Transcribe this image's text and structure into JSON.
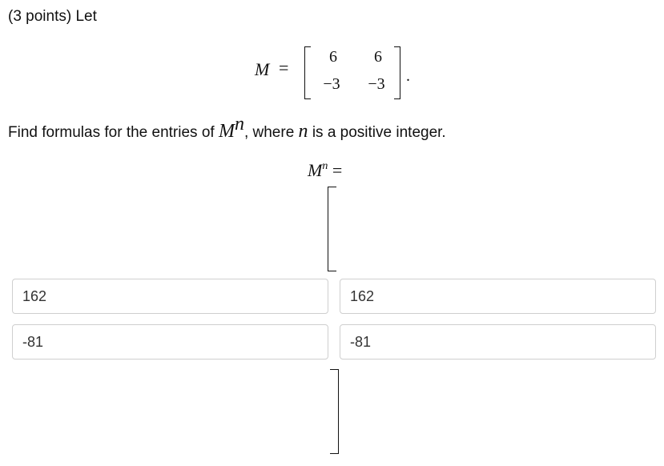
{
  "header": {
    "text": "(3 points) Let"
  },
  "matrix_m": {
    "symbol": "M",
    "equals": "=",
    "entries": [
      [
        "6",
        "6"
      ],
      [
        "−3",
        "−3"
      ]
    ],
    "period": "."
  },
  "prompt": {
    "before": "Find formulas for the entries of ",
    "base": "M",
    "exponent": "n",
    "middle": ", where ",
    "var": "n",
    "after": " is a positive integer."
  },
  "result_label": {
    "base": "M",
    "exponent": "n",
    "equals": "="
  },
  "answer_inputs": [
    [
      "162",
      "162"
    ],
    [
      "-81",
      "-81"
    ]
  ]
}
